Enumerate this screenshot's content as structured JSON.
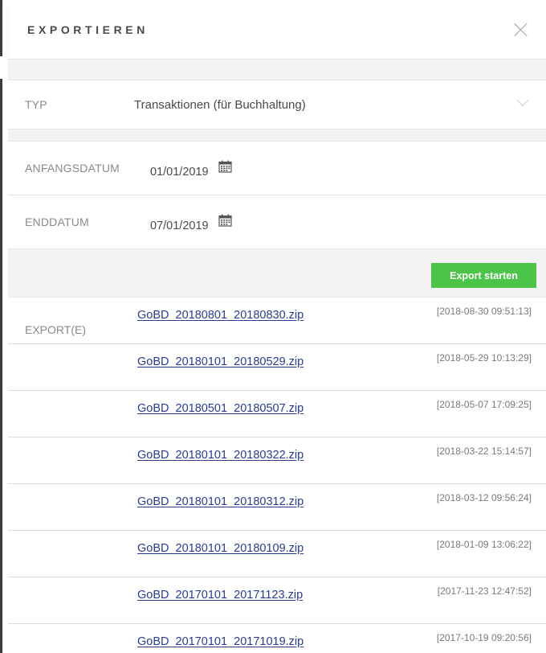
{
  "header": {
    "title": "EXPORTIEREN"
  },
  "type": {
    "label": "TYP",
    "value": "Transaktionen (für Buchhaltung)"
  },
  "start_date": {
    "label": "ANFANGSDATUM",
    "value": "01/01/2019"
  },
  "end_date": {
    "label": "ENDDATUM",
    "value": "07/01/2019"
  },
  "export_button": {
    "label": "Export starten"
  },
  "exports": {
    "label": "EXPORT(E)",
    "items": [
      {
        "file": "GoBD_20180801_20180830.zip",
        "time": "[2018-08-30 09:51:13]"
      },
      {
        "file": "GoBD_20180101_20180529.zip",
        "time": "[2018-05-29 10:13:29]"
      },
      {
        "file": "GoBD_20180501_20180507.zip",
        "time": "[2018-05-07 17:09:25]"
      },
      {
        "file": "GoBD_20180101_20180322.zip",
        "time": "[2018-03-22 15:14:57]"
      },
      {
        "file": "GoBD_20180101_20180312.zip",
        "time": "[2018-03-12 09:56:24]"
      },
      {
        "file": "GoBD_20180101_20180109.zip",
        "time": "[2018-01-09 13:06:22]"
      },
      {
        "file": "GoBD_20170101_20171123.zip",
        "time": "[2017-11-23 12:47:52]"
      },
      {
        "file": "GoBD_20170101_20171019.zip",
        "time": "[2017-10-19 09:20:56]"
      }
    ]
  },
  "colors": {
    "accent": "#4cc44a",
    "link": "#2b3c8e"
  },
  "icons": {
    "close": "close-icon",
    "dropdown": "chevron-down-icon",
    "calendar": "calendar-icon"
  }
}
